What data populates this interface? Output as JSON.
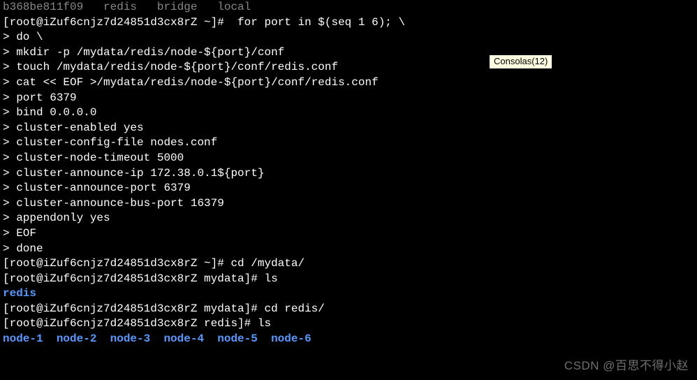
{
  "top_partial": "b368be811f09   redis   bridge   local",
  "lines": [
    "[root@iZuf6cnjz7d24851d3cx8rZ ~]#  for port in $(seq 1 6); \\",
    "> do \\",
    "> mkdir -p /mydata/redis/node-${port}/conf",
    "> touch /mydata/redis/node-${port}/conf/redis.conf",
    "> cat << EOF >/mydata/redis/node-${port}/conf/redis.conf",
    "> port 6379",
    "> bind 0.0.0.0",
    "> cluster-enabled yes",
    "> cluster-config-file nodes.conf",
    "> cluster-node-timeout 5000",
    "> cluster-announce-ip 172.38.0.1${port}",
    "> cluster-announce-port 6379",
    "> cluster-announce-bus-port 16379",
    "> appendonly yes",
    "> EOF",
    "> done",
    "[root@iZuf6cnjz7d24851d3cx8rZ ~]# cd /mydata/",
    "[root@iZuf6cnjz7d24851d3cx8rZ mydata]# ls"
  ],
  "ls_mydata": "redis",
  "lines2": [
    "[root@iZuf6cnjz7d24851d3cx8rZ mydata]# cd redis/",
    "[root@iZuf6cnjz7d24851d3cx8rZ redis]# ls"
  ],
  "nodes": [
    "node-1",
    "node-2",
    "node-3",
    "node-4",
    "node-5",
    "node-6"
  ],
  "tooltip": "Consolas(12)",
  "watermark": "CSDN @百思不得小赵"
}
